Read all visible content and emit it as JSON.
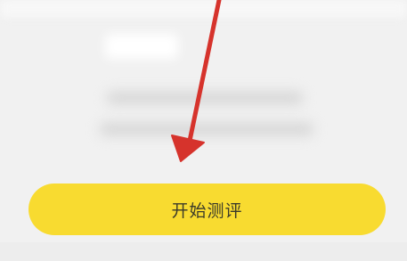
{
  "start_button": {
    "label": "开始测评"
  },
  "colors": {
    "background": "#f1f1f1",
    "button": "#f8db30",
    "arrow": "#d6332c"
  },
  "annotation": {
    "icon": "red-arrow-icon"
  }
}
